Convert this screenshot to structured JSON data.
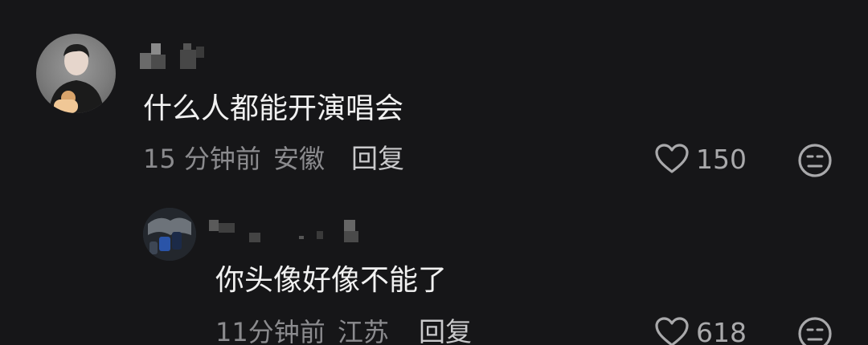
{
  "comments": [
    {
      "username": "",
      "text": "什么人都能开演唱会",
      "time": "15 分钟前",
      "location": "安徽",
      "reply_label": "回复",
      "likes": "150"
    },
    {
      "username": "",
      "text": "你头像好像不能了",
      "time": "11分钟前",
      "location": "江苏",
      "reply_label": "回复",
      "likes": "618"
    }
  ],
  "icons": {
    "like": "heart-outline-icon",
    "dislike": "meh-face-icon"
  },
  "colors": {
    "background": "#161618",
    "text": "#f1f1f1",
    "meta": "#8b8b8e"
  }
}
